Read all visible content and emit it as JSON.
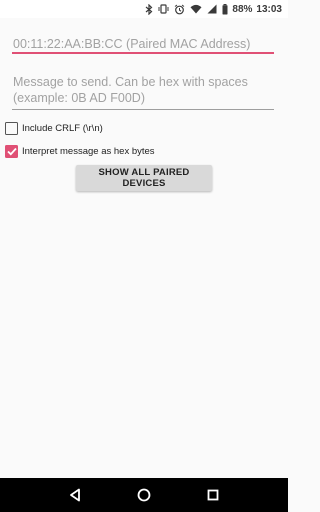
{
  "status_bar": {
    "battery_percent": "88%",
    "time": "13:03",
    "icons": [
      "bluetooth-icon",
      "vibrate-icon",
      "alarm-icon",
      "wifi-icon",
      "signal-icon",
      "battery-icon"
    ]
  },
  "mac_field": {
    "placeholder": "00:11:22:AA:BB:CC (Paired MAC Address)",
    "value": ""
  },
  "message_field": {
    "placeholder": "Message to send. Can be hex with spaces (example: 0B AD F00D)",
    "value": ""
  },
  "checkboxes": [
    {
      "label": "Include CRLF (\\r\\n)",
      "checked": false
    },
    {
      "label": "Interpret message as hex bytes",
      "checked": true
    }
  ],
  "show_devices_button": {
    "label": "SHOW ALL PAIRED DEVICES"
  },
  "nav_bar": {
    "icons": [
      "back-icon",
      "home-icon",
      "recents-icon"
    ]
  },
  "colors": {
    "accent": "#e05075",
    "nav_bar": "#000000",
    "background": "#fafafa"
  }
}
